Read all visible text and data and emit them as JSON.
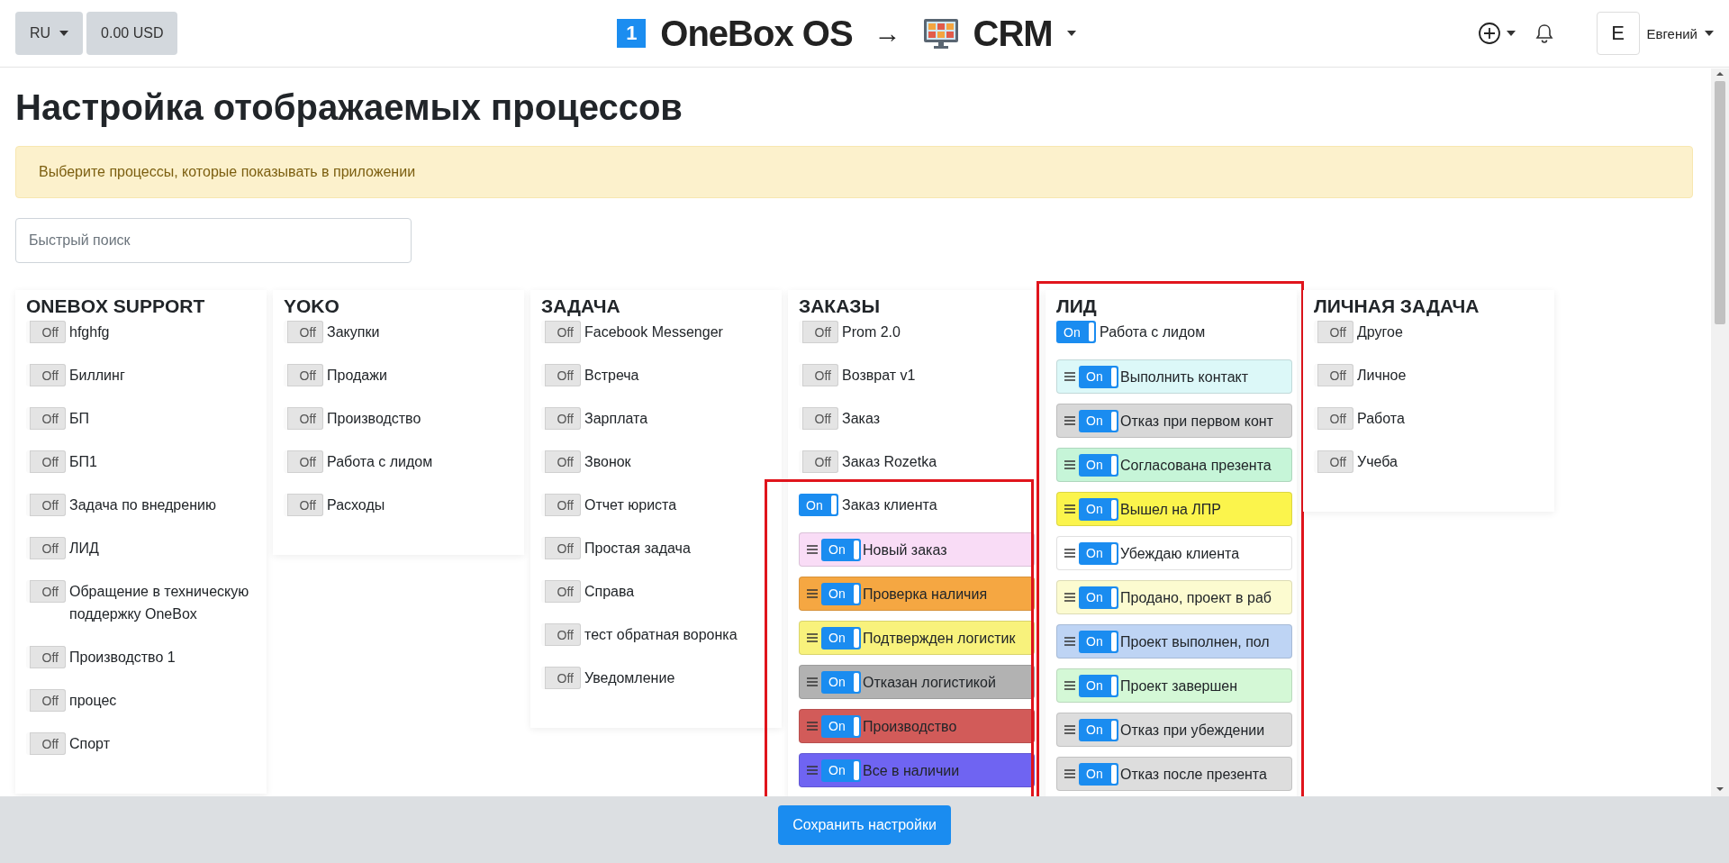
{
  "header": {
    "language": "RU",
    "balance": "0.00 USD",
    "logo_mark": "1",
    "app_name": "OneBox OS",
    "arrow": "→",
    "module": "CRM",
    "user_initial": "E",
    "user_name": "Евгений"
  },
  "page": {
    "title": "Настройка отображаемых процессов",
    "notice": "Выберите процессы, которые показывать в приложении",
    "search": {
      "placeholder": "Быстрый поиск"
    }
  },
  "columns": [
    {
      "title": "ONEBOX SUPPORT",
      "items": [
        {
          "label": "hfghfg",
          "on": false,
          "toggle_text": "Off"
        },
        {
          "label": "Биллинг",
          "on": false,
          "toggle_text": "Off"
        },
        {
          "label": "БП",
          "on": false,
          "toggle_text": "Off"
        },
        {
          "label": "БП1",
          "on": false,
          "toggle_text": "Off"
        },
        {
          "label": "Задача по внедрению",
          "on": false,
          "toggle_text": "Off"
        },
        {
          "label": "ЛИД",
          "on": false,
          "toggle_text": "Off"
        },
        {
          "label": "Обращение в техническую поддержку OneBox",
          "on": false,
          "toggle_text": "Off"
        },
        {
          "label": "Производство 1",
          "on": false,
          "toggle_text": "Off"
        },
        {
          "label": "процес",
          "on": false,
          "toggle_text": "Off"
        },
        {
          "label": "Спорт",
          "on": false,
          "toggle_text": "Off"
        }
      ]
    },
    {
      "title": "YOKO",
      "items": [
        {
          "label": "Закупки",
          "on": false,
          "toggle_text": "Off"
        },
        {
          "label": "Продажи",
          "on": false,
          "toggle_text": "Off"
        },
        {
          "label": "Производство",
          "on": false,
          "toggle_text": "Off"
        },
        {
          "label": "Работа с лидом",
          "on": false,
          "toggle_text": "Off"
        },
        {
          "label": "Расходы",
          "on": false,
          "toggle_text": "Off"
        }
      ]
    },
    {
      "title": "ЗАДАЧА",
      "items": [
        {
          "label": "Facebook Messenger",
          "on": false,
          "toggle_text": "Off"
        },
        {
          "label": "Встреча",
          "on": false,
          "toggle_text": "Off"
        },
        {
          "label": "Зарплата",
          "on": false,
          "toggle_text": "Off"
        },
        {
          "label": "Звонок",
          "on": false,
          "toggle_text": "Off"
        },
        {
          "label": "Отчет юриста",
          "on": false,
          "toggle_text": "Off"
        },
        {
          "label": "Простая задача",
          "on": false,
          "toggle_text": "Off"
        },
        {
          "label": "Справа",
          "on": false,
          "toggle_text": "Off"
        },
        {
          "label": "тест обратная воронка",
          "on": false,
          "toggle_text": "Off"
        },
        {
          "label": "Уведомление",
          "on": false,
          "toggle_text": "Off"
        }
      ]
    },
    {
      "title": "ЗАКАЗЫ",
      "items": [
        {
          "label": "Prom 2.0",
          "on": false,
          "toggle_text": "Off"
        },
        {
          "label": "Возврат v1",
          "on": false,
          "toggle_text": "Off"
        },
        {
          "label": "Заказ",
          "on": false,
          "toggle_text": "Off"
        },
        {
          "label": "Заказ Rozetka",
          "on": false,
          "toggle_text": "Off"
        },
        {
          "label": "Заказ клиента",
          "on": true,
          "toggle_text": "On",
          "highlighted": true,
          "stages": [
            {
              "label": "Новый заказ",
              "on": true,
              "toggle_text": "On",
              "color": "#f9dcf6"
            },
            {
              "label": "Проверка наличия",
              "on": true,
              "toggle_text": "On",
              "color": "#f5a742"
            },
            {
              "label": "Подтвержден логистик",
              "on": true,
              "toggle_text": "On",
              "color": "#f8f27c"
            },
            {
              "label": "Отказан логистикой",
              "on": true,
              "toggle_text": "On",
              "color": "#b2b2b2"
            },
            {
              "label": "Производство",
              "on": true,
              "toggle_text": "On",
              "color": "#d25b59"
            },
            {
              "label": "Все в наличии",
              "on": true,
              "toggle_text": "On",
              "color": "#6f64f2"
            }
          ]
        }
      ]
    },
    {
      "title": "ЛИД",
      "highlighted": true,
      "items": [
        {
          "label": "Работа с лидом",
          "on": true,
          "toggle_text": "On",
          "stages": [
            {
              "label": "Выполнить контакт",
              "on": true,
              "toggle_text": "On",
              "color": "#dcf8f8"
            },
            {
              "label": "Отказ при первом конт",
              "on": true,
              "toggle_text": "On",
              "color": "#d8d8d8"
            },
            {
              "label": "Согласована презента",
              "on": true,
              "toggle_text": "On",
              "color": "#c6f5d8"
            },
            {
              "label": "Вышел на ЛПР",
              "on": true,
              "toggle_text": "On",
              "color": "#fbf44c"
            },
            {
              "label": "Убеждаю клиента",
              "on": true,
              "toggle_text": "On",
              "color": "#ffffff"
            },
            {
              "label": "Продано, проект в раб",
              "on": true,
              "toggle_text": "On",
              "color": "#fcfbd0"
            },
            {
              "label": "Проект выполнен, пол",
              "on": true,
              "toggle_text": "On",
              "color": "#bed4f4"
            },
            {
              "label": "Проект завершен",
              "on": true,
              "toggle_text": "On",
              "color": "#d4f8d6"
            },
            {
              "label": "Отказ при убеждении",
              "on": true,
              "toggle_text": "On",
              "color": "#dddddd"
            },
            {
              "label": "Отказ после презента",
              "on": true,
              "toggle_text": "On",
              "color": "#dddddd"
            }
          ]
        }
      ]
    },
    {
      "title": "ЛИЧНАЯ ЗАДАЧА",
      "items": [
        {
          "label": "Другое",
          "on": false,
          "toggle_text": "Off"
        },
        {
          "label": "Личное",
          "on": false,
          "toggle_text": "Off"
        },
        {
          "label": "Работа",
          "on": false,
          "toggle_text": "Off"
        },
        {
          "label": "Учеба",
          "on": false,
          "toggle_text": "Off"
        }
      ]
    }
  ],
  "footer": {
    "save_button": "Сохранить настройки"
  }
}
